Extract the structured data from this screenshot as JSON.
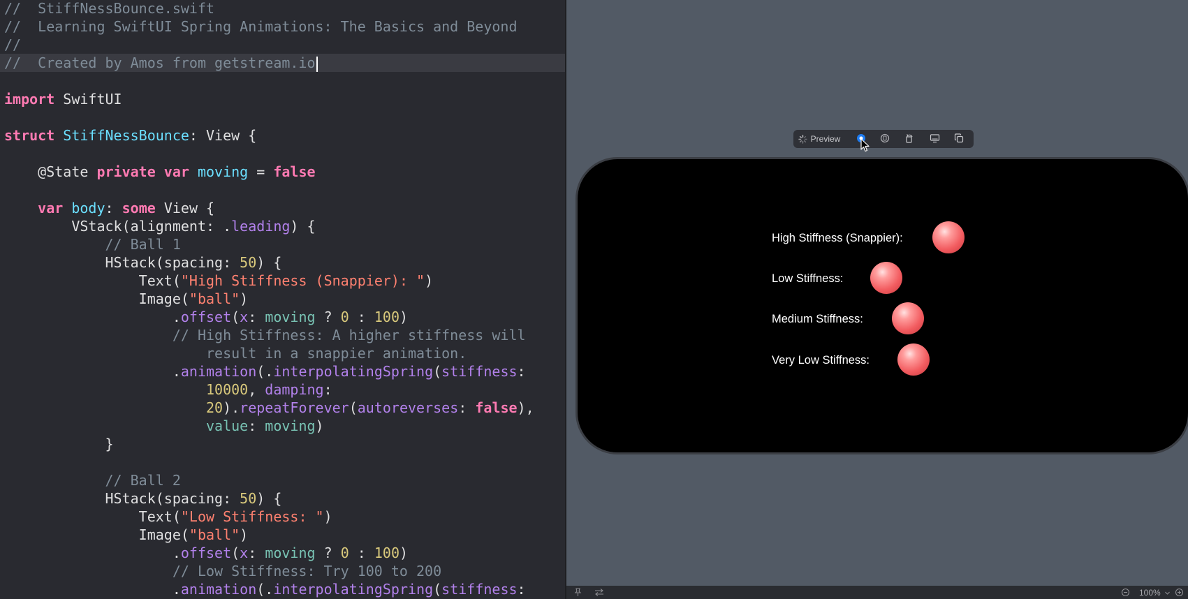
{
  "editor": {
    "lines": [
      [
        {
          "c": "cm",
          "t": "//  StiffNessBounce.swift"
        }
      ],
      [
        {
          "c": "cm",
          "t": "//  Learning SwiftUI Spring Animations: The Basics and Beyond"
        }
      ],
      [
        {
          "c": "cm",
          "t": "//"
        }
      ],
      [
        {
          "c": "cm",
          "t": "//  Created by Amos from getstream.io"
        }
      ],
      [],
      [
        {
          "c": "kw",
          "t": "import"
        },
        {
          "c": "pl",
          "t": " SwiftUI"
        }
      ],
      [],
      [
        {
          "c": "kw",
          "t": "struct"
        },
        {
          "c": "pl",
          "t": " "
        },
        {
          "c": "tp",
          "t": "StiffNessBounce"
        },
        {
          "c": "pl",
          "t": ": View {"
        }
      ],
      [],
      [
        {
          "c": "pl",
          "t": "    @State "
        },
        {
          "c": "kw",
          "t": "private"
        },
        {
          "c": "pl",
          "t": " "
        },
        {
          "c": "kw",
          "t": "var"
        },
        {
          "c": "pl",
          "t": " "
        },
        {
          "c": "tp",
          "t": "moving"
        },
        {
          "c": "pl",
          "t": " = "
        },
        {
          "c": "kw",
          "t": "false"
        }
      ],
      [],
      [
        {
          "c": "pl",
          "t": "    "
        },
        {
          "c": "kw",
          "t": "var"
        },
        {
          "c": "pl",
          "t": " "
        },
        {
          "c": "tp",
          "t": "body"
        },
        {
          "c": "pl",
          "t": ": "
        },
        {
          "c": "kw",
          "t": "some"
        },
        {
          "c": "pl",
          "t": " View {"
        }
      ],
      [
        {
          "c": "pl",
          "t": "        VStack(alignment: ."
        },
        {
          "c": "fn",
          "t": "leading"
        },
        {
          "c": "pl",
          "t": ") {"
        }
      ],
      [
        {
          "c": "cm",
          "t": "            // Ball 1"
        }
      ],
      [
        {
          "c": "pl",
          "t": "            HStack(spacing: "
        },
        {
          "c": "nm",
          "t": "50"
        },
        {
          "c": "pl",
          "t": ") {"
        }
      ],
      [
        {
          "c": "pl",
          "t": "                Text("
        },
        {
          "c": "st",
          "t": "\"High Stiffness (Snappier): \""
        },
        {
          "c": "pl",
          "t": ")"
        }
      ],
      [
        {
          "c": "pl",
          "t": "                Image("
        },
        {
          "c": "st",
          "t": "\"ball\""
        },
        {
          "c": "pl",
          "t": ")"
        }
      ],
      [
        {
          "c": "pl",
          "t": "                    ."
        },
        {
          "c": "fn",
          "t": "offset"
        },
        {
          "c": "pl",
          "t": "("
        },
        {
          "c": "fn",
          "t": "x"
        },
        {
          "c": "pl",
          "t": ": "
        },
        {
          "c": "pr",
          "t": "moving"
        },
        {
          "c": "pl",
          "t": " ? "
        },
        {
          "c": "nm",
          "t": "0"
        },
        {
          "c": "pl",
          "t": " : "
        },
        {
          "c": "nm",
          "t": "100"
        },
        {
          "c": "pl",
          "t": ")"
        }
      ],
      [
        {
          "c": "cm",
          "t": "                    // High Stiffness: A higher stiffness will"
        }
      ],
      [
        {
          "c": "cm",
          "t": "                        result in a snappier animation."
        }
      ],
      [
        {
          "c": "pl",
          "t": "                    ."
        },
        {
          "c": "fn",
          "t": "animation"
        },
        {
          "c": "pl",
          "t": "(."
        },
        {
          "c": "fn",
          "t": "interpolatingSpring"
        },
        {
          "c": "pl",
          "t": "("
        },
        {
          "c": "fn",
          "t": "stiffness"
        },
        {
          "c": "pl",
          "t": ":"
        }
      ],
      [
        {
          "c": "pl",
          "t": "                        "
        },
        {
          "c": "nm",
          "t": "10000"
        },
        {
          "c": "pl",
          "t": ", "
        },
        {
          "c": "fn",
          "t": "damping"
        },
        {
          "c": "pl",
          "t": ":"
        }
      ],
      [
        {
          "c": "pl",
          "t": "                        "
        },
        {
          "c": "nm",
          "t": "20"
        },
        {
          "c": "pl",
          "t": ")."
        },
        {
          "c": "fn",
          "t": "repeatForever"
        },
        {
          "c": "pl",
          "t": "("
        },
        {
          "c": "fn",
          "t": "autoreverses"
        },
        {
          "c": "pl",
          "t": ": "
        },
        {
          "c": "kw",
          "t": "false"
        },
        {
          "c": "pl",
          "t": "),"
        }
      ],
      [
        {
          "c": "pl",
          "t": "                        "
        },
        {
          "c": "pr",
          "t": "value"
        },
        {
          "c": "pl",
          "t": ": "
        },
        {
          "c": "pr",
          "t": "moving"
        },
        {
          "c": "pl",
          "t": ")"
        }
      ],
      [
        {
          "c": "pl",
          "t": "            }"
        }
      ],
      [],
      [
        {
          "c": "cm",
          "t": "            // Ball 2"
        }
      ],
      [
        {
          "c": "pl",
          "t": "            HStack(spacing: "
        },
        {
          "c": "nm",
          "t": "50"
        },
        {
          "c": "pl",
          "t": ") {"
        }
      ],
      [
        {
          "c": "pl",
          "t": "                Text("
        },
        {
          "c": "st",
          "t": "\"Low Stiffness: \""
        },
        {
          "c": "pl",
          "t": ")"
        }
      ],
      [
        {
          "c": "pl",
          "t": "                Image("
        },
        {
          "c": "st",
          "t": "\"ball\""
        },
        {
          "c": "pl",
          "t": ")"
        }
      ],
      [
        {
          "c": "pl",
          "t": "                    ."
        },
        {
          "c": "fn",
          "t": "offset"
        },
        {
          "c": "pl",
          "t": "("
        },
        {
          "c": "fn",
          "t": "x"
        },
        {
          "c": "pl",
          "t": ": "
        },
        {
          "c": "pr",
          "t": "moving"
        },
        {
          "c": "pl",
          "t": " ? "
        },
        {
          "c": "nm",
          "t": "0"
        },
        {
          "c": "pl",
          "t": " : "
        },
        {
          "c": "nm",
          "t": "100"
        },
        {
          "c": "pl",
          "t": ")"
        }
      ],
      [
        {
          "c": "cm",
          "t": "                    // Low Stiffness: Try 100 to 200"
        }
      ],
      [
        {
          "c": "pl",
          "t": "                    ."
        },
        {
          "c": "fn",
          "t": "animation"
        },
        {
          "c": "pl",
          "t": "(."
        },
        {
          "c": "fn",
          "t": "interpolatingSpring"
        },
        {
          "c": "pl",
          "t": "("
        },
        {
          "c": "fn",
          "t": "stiffness"
        },
        {
          "c": "pl",
          "t": ":"
        }
      ]
    ],
    "cursor_line": 3
  },
  "preview": {
    "toolbar": {
      "preview_label": "Preview",
      "buttons": [
        "live-mode",
        "selectable-mode",
        "rotate-device",
        "device-settings",
        "duplicate-preview"
      ]
    },
    "rows": [
      {
        "label": "High Stiffness (Snappier):"
      },
      {
        "label": "Low Stiffness:"
      },
      {
        "label": "Medium Stiffness:"
      },
      {
        "label": "Very Low Stiffness:"
      }
    ],
    "ball_color": "#f25c60"
  },
  "status": {
    "zoom": "100%"
  },
  "colors": {
    "editor_bg": "#292a30",
    "canvas_bg": "#525a65",
    "keyword": "#ff7ab2",
    "type_decl": "#6bdfff",
    "string": "#ff8170",
    "number": "#d9c97c",
    "comment": "#7f8c98",
    "method": "#b281eb"
  }
}
